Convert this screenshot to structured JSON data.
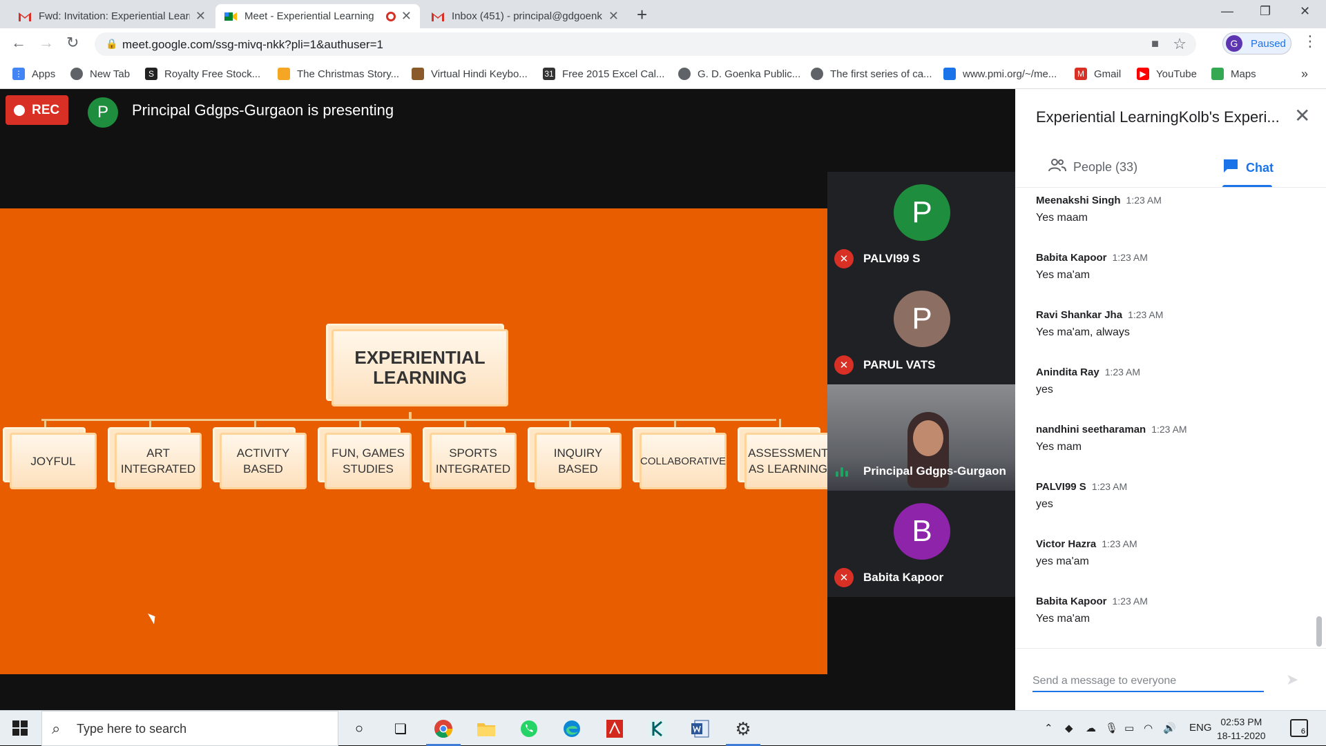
{
  "browser": {
    "tabs": [
      {
        "title": "Fwd: Invitation: Experiential Learn",
        "icon": "gmail-icon"
      },
      {
        "title": "Meet - Experiential Learning",
        "icon": "meet-icon",
        "recording": true
      },
      {
        "title": "Inbox (451) - principal@gdgoenk",
        "icon": "gmail-icon"
      }
    ],
    "new_tab": "+",
    "url": "meet.google.com/ssg-mivq-nkk?pli=1&authuser=1",
    "profile_initial": "G",
    "profile_status": "Paused",
    "bookmarks": [
      {
        "label": "Apps",
        "color": "#4285f4"
      },
      {
        "label": "New Tab",
        "color": "#5f6368"
      },
      {
        "label": "Royalty Free Stock...",
        "color": "#222222"
      },
      {
        "label": "The Christmas Story...",
        "color": "#f5a623"
      },
      {
        "label": "Virtual Hindi Keybo...",
        "color": "#8b5a2b"
      },
      {
        "label": "Free 2015 Excel Cal...",
        "color": "#333333"
      },
      {
        "label": "G. D. Goenka Public...",
        "color": "#5f6368"
      },
      {
        "label": "The first series of ca...",
        "color": "#5f6368"
      },
      {
        "label": "www.pmi.org/~/me...",
        "color": "#1a73e8"
      },
      {
        "label": "Gmail",
        "color": "#d93025"
      },
      {
        "label": "YouTube",
        "color": "#ff0000"
      },
      {
        "label": "Maps",
        "color": "#34a853"
      }
    ],
    "bookmarks_more": "»"
  },
  "meet": {
    "rec_label": "REC",
    "presenter_initial": "P",
    "presenting_text": "Principal Gdgps-Gurgaon is presenting",
    "slide": {
      "root": "EXPERIENTIAL LEARNING",
      "children": [
        "JOYFUL",
        "ART INTEGRATED",
        "ACTIVITY BASED",
        "FUN, GAMES STUDIES",
        "SPORTS INTEGRATED",
        "INQUIRY BASED",
        "COLLABORATIVE",
        "ASSESSMENT AS LEARNING"
      ]
    },
    "participants": [
      {
        "initial": "P",
        "name": "PALVI99 S",
        "color": "#1e8e3e",
        "muted": true
      },
      {
        "initial": "P",
        "name": "PARUL VATS",
        "color": "#8d6e63",
        "muted": true
      },
      {
        "initial": "",
        "name": "Principal Gdgps-Gurgaon",
        "video": true,
        "speaking": true
      },
      {
        "initial": "B",
        "name": "Babita Kapoor",
        "color": "#8e24aa",
        "muted": true
      }
    ]
  },
  "panel": {
    "title": "Experiential LearningKolb's Experi...",
    "people_label": "People (33)",
    "chat_label": "Chat",
    "messages": [
      {
        "name": "Meenakshi Singh",
        "time": "1:23 AM",
        "text": "Yes maam"
      },
      {
        "name": "Babita Kapoor",
        "time": "1:23 AM",
        "text": "Yes ma'am"
      },
      {
        "name": "Ravi Shankar Jha",
        "time": "1:23 AM",
        "text": "Yes ma'am, always"
      },
      {
        "name": "Anindita Ray",
        "time": "1:23 AM",
        "text": "yes"
      },
      {
        "name": "nandhini seetharaman",
        "time": "1:23 AM",
        "text": "Yes mam"
      },
      {
        "name": "PALVI99 S",
        "time": "1:23 AM",
        "text": "yes"
      },
      {
        "name": "Victor Hazra",
        "time": "1:23 AM",
        "text": "yes ma'am"
      },
      {
        "name": "Babita Kapoor",
        "time": "1:23 AM",
        "text": "Yes ma'am"
      }
    ],
    "compose_placeholder": "Send a message to everyone"
  },
  "taskbar": {
    "search_placeholder": "Type here to search",
    "language": "ENG",
    "time": "02:53 PM",
    "date": "18-11-2020",
    "notification_count": "6"
  }
}
